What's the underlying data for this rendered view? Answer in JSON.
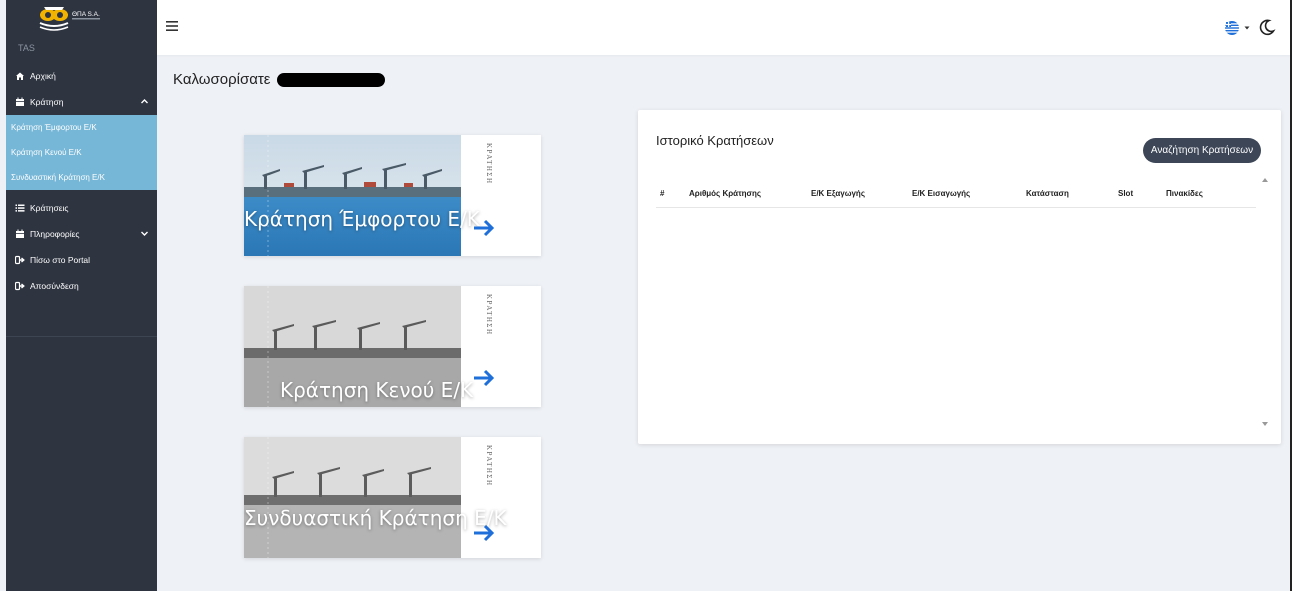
{
  "app": {
    "logo_text": "ΘΠΑ S.A.",
    "brand_sub": "TAS"
  },
  "sidebar": {
    "items": [
      {
        "label": "Αρχική",
        "icon": "home-icon"
      },
      {
        "label": "Κράτηση",
        "icon": "calendar-icon",
        "expanded": true
      },
      {
        "label": "Κράτησεις",
        "icon": "list-icon"
      },
      {
        "label": "Πληροφορίες",
        "icon": "calendar-icon",
        "expanded": false
      },
      {
        "label": "Πίσω στο Portal",
        "icon": "sign-out-icon"
      },
      {
        "label": "Αποσύνδεση",
        "icon": "sign-out-icon"
      }
    ],
    "sub_items": [
      {
        "label": "Κράτηση Έμφορτου Ε/Κ"
      },
      {
        "label": "Κράτηση Κενού Ε/Κ"
      },
      {
        "label": "Συνδυαστική Κράτηση Ε/Κ"
      }
    ],
    "sub_bg_color": "#76b6d6",
    "bg_color": "#2e3440"
  },
  "topbar": {
    "language": "Greek",
    "theme_toggle_icon": "moon-icon"
  },
  "welcome": {
    "text": "Καλωσορίσατε"
  },
  "cards": [
    {
      "title": "Κράτηση Έμφορτου Ε/Κ",
      "side_label": "ΚΡΑΤΗΣΗ",
      "tone": "color"
    },
    {
      "title": "Κράτηση Κενού Ε/Κ",
      "side_label": "ΚΡΑΤΗΣΗ",
      "tone": "grayscale"
    },
    {
      "title": "Συνδυαστική Κράτηση Ε/Κ",
      "side_label": "ΚΡΑΤΗΣΗ",
      "tone": "grayscale"
    }
  ],
  "history": {
    "title": "Ιστορικό Κρατήσεων",
    "search_button": "Αναζήτηση Κρατήσεων",
    "columns": [
      "#",
      "Αριθμός Κράτησης",
      "Ε/Κ Εξαγωγής",
      "Ε/Κ Εισαγωγής",
      "Κατάσταση",
      "Slot",
      "Πινακίδες"
    ],
    "rows": []
  },
  "colors": {
    "accent": "#1e6fd9",
    "dark_button": "#3c4657"
  }
}
